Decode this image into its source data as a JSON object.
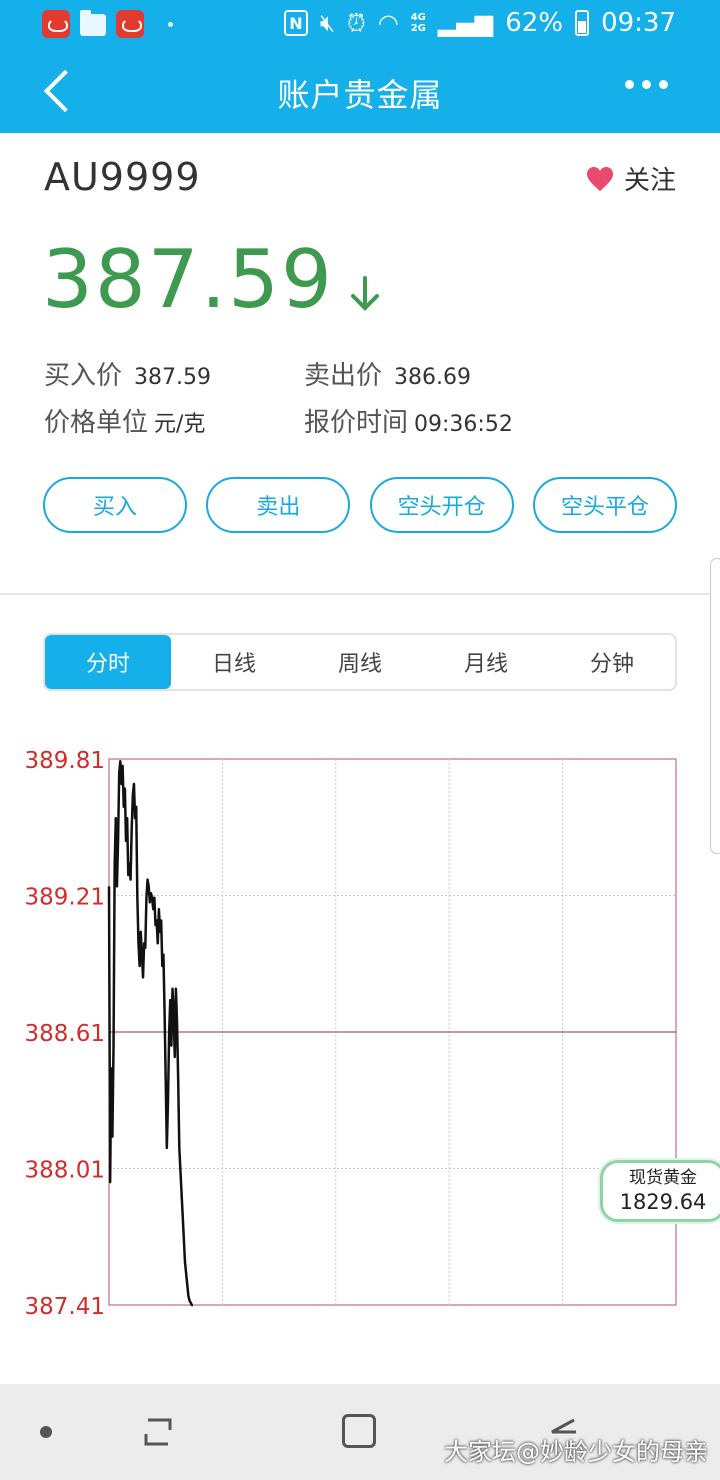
{
  "status_bar": {
    "battery": "62%",
    "time": "09:37",
    "net_top": "4G",
    "net_bottom": "2G"
  },
  "header": {
    "title": "账户贵金属"
  },
  "instrument": {
    "symbol": "AU9999",
    "follow_label": "关注",
    "price": "387.59",
    "trend": "down",
    "price_color": "#3e9a4f"
  },
  "quote": {
    "buy_label": "买入价",
    "buy_value": "387.59",
    "sell_label": "卖出价",
    "sell_value": "386.69",
    "unit_label": "价格单位",
    "unit_value": "元/克",
    "time_label": "报价时间",
    "time_value": "09:36:52"
  },
  "actions": [
    "买入",
    "卖出",
    "空头开仓",
    "空头平仓"
  ],
  "tabs": [
    {
      "label": "分时",
      "active": true
    },
    {
      "label": "日线",
      "active": false
    },
    {
      "label": "周线",
      "active": false
    },
    {
      "label": "月线",
      "active": false
    },
    {
      "label": "分钟",
      "active": false
    }
  ],
  "chart_data": {
    "type": "line",
    "title": "",
    "xlabel": "",
    "ylabel": "",
    "ylim": [
      387.41,
      389.81
    ],
    "y_ticks": [
      "389.81",
      "389.21",
      "388.61",
      "388.01",
      "387.41"
    ],
    "reference_line": 388.61,
    "x_divisions": 5,
    "grid": true,
    "series": [
      {
        "x": [
          0,
          0.5,
          1,
          1.5,
          2,
          2.5,
          3,
          3.5,
          4,
          4.5,
          5,
          5.5,
          6,
          6.5,
          7,
          7.5,
          8,
          8.5,
          9,
          9.5,
          10,
          10.5,
          11,
          11.5,
          12,
          12.5,
          13,
          13.5,
          14,
          14.5,
          15,
          15.5,
          16,
          16.5,
          17,
          17.5,
          18,
          18.5,
          19,
          19.5,
          20,
          20.5,
          21,
          21.5,
          22,
          22.5,
          23,
          23.5,
          24,
          24.5,
          25,
          25.5,
          26,
          26.5,
          27,
          27.5,
          28,
          28.5,
          29,
          29.5,
          30,
          30.5,
          31,
          31.5,
          32,
          32.5,
          33,
          33.5,
          34,
          34.5,
          35,
          35.5,
          36,
          36.5,
          37,
          37.5,
          38,
          38.5,
          39,
          39.5,
          40,
          40.5,
          41,
          41.5,
          42,
          42.5,
          43,
          43.5,
          44,
          44.5,
          45,
          45.5,
          46,
          46.5,
          47,
          47.5,
          48,
          48.5,
          49,
          49.5,
          50
        ],
        "values": [
          389.25,
          387.95,
          388.45,
          388.15,
          388.55,
          389.35,
          389.55,
          389.25,
          389.45,
          389.75,
          389.8,
          389.7,
          389.78,
          389.6,
          389.68,
          389.45,
          389.55,
          389.3,
          389.35,
          389.28,
          389.5,
          389.65,
          389.7,
          389.55,
          389.6,
          389.2,
          389.0,
          388.9,
          389.05,
          388.95,
          388.85,
          389.0,
          388.98,
          389.2,
          389.28,
          389.25,
          389.18,
          389.22,
          389.2,
          389.15,
          389.2,
          389.08,
          389.1,
          389.0,
          389.15,
          389.05,
          389.1,
          388.9,
          388.95,
          388.7,
          388.4,
          388.1,
          388.3,
          388.6,
          388.75,
          388.55,
          388.8,
          388.7,
          388.5,
          388.8,
          388.65,
          388.4,
          388.1,
          388.0,
          387.9,
          387.8,
          387.7,
          387.6,
          387.55,
          387.5,
          387.45,
          387.43,
          387.42,
          387.41,
          387.41,
          387.41,
          387.41,
          387.41,
          387.41,
          387.41,
          387.41,
          387.41,
          387.41,
          387.41,
          387.41,
          387.41,
          387.41,
          387.41,
          387.41,
          387.41,
          387.41,
          387.41,
          387.41,
          387.41,
          387.41,
          387.41,
          387.41,
          387.41,
          387.41,
          387.41,
          387.41
        ]
      }
    ],
    "x_max": 250
  },
  "gold_chip": {
    "name": "现货黄金",
    "value": "1829.64"
  },
  "watermark": "大家坛@妙龄少女的母亲"
}
